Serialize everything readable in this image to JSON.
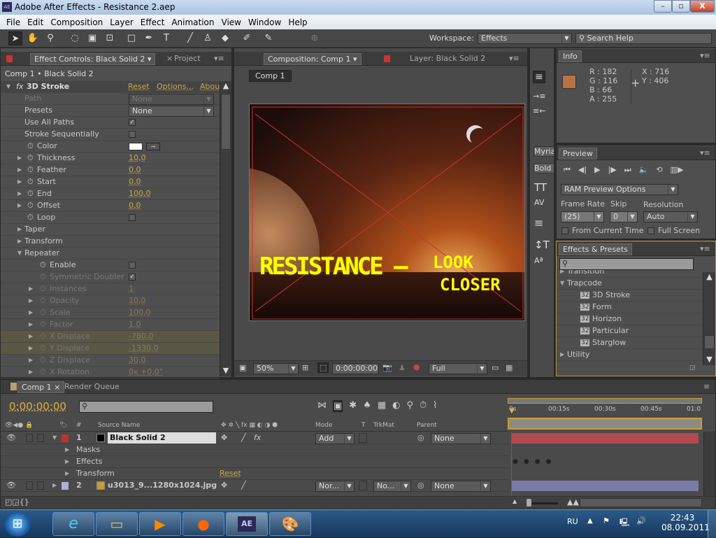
{
  "window": {
    "title": "Adobe After Effects - Resistance 2.aep",
    "app_icon": "AE",
    "minimize": "–",
    "maximize": "▫",
    "close": "X"
  },
  "menu": [
    "File",
    "Edit",
    "Composition",
    "Layer",
    "Effect",
    "Animation",
    "View",
    "Window",
    "Help"
  ],
  "toolbar": {
    "workspace_label": "Workspace:",
    "workspace_value": "Effects",
    "search_placeholder": "Search Help"
  },
  "effect_controls": {
    "tab": "Effect Controls: Black Solid 2",
    "tab_project": "Project",
    "breadcrumb": "Comp 1 • Black Solid 2",
    "effect_name": "3D Stroke",
    "reset": "Reset",
    "options": "Options...",
    "about": "About...",
    "rows": [
      {
        "label": "Path",
        "value": "None",
        "type": "dropdown",
        "dim": true
      },
      {
        "label": "Presets",
        "value": "None",
        "type": "dropdown"
      },
      {
        "label": "Use All Paths",
        "value": "✓",
        "type": "check"
      },
      {
        "label": "Stroke Sequentially",
        "value": "",
        "type": "check"
      },
      {
        "label": "Color",
        "value": "#ffffff",
        "type": "color",
        "sw": true
      },
      {
        "label": "Thickness",
        "value": "10,0",
        "type": "num",
        "sw": true,
        "tw": true
      },
      {
        "label": "Feather",
        "value": "0,0",
        "type": "num",
        "sw": true,
        "tw": true
      },
      {
        "label": "Start",
        "value": "0,0",
        "type": "num",
        "sw": true,
        "tw": true
      },
      {
        "label": "End",
        "value": "100,0",
        "type": "num",
        "sw": true,
        "tw": true
      },
      {
        "label": "Offset",
        "value": "0,0",
        "type": "num",
        "sw": true,
        "tw": true
      },
      {
        "label": "Loop",
        "value": "",
        "type": "check",
        "sw": true
      },
      {
        "label": "Taper",
        "type": "group",
        "tw": true
      },
      {
        "label": "Transform",
        "type": "group",
        "tw": true
      },
      {
        "label": "Repeater",
        "type": "group",
        "tw": true,
        "open": true
      },
      {
        "label": "Enable",
        "value": "",
        "type": "check",
        "sw": true,
        "indent": true
      },
      {
        "label": "Symmetric Doubler",
        "value": "✓",
        "type": "check",
        "sw": true,
        "indent": true,
        "dim": true
      },
      {
        "label": "Instances",
        "value": "1",
        "type": "num",
        "sw": true,
        "tw": true,
        "indent": true,
        "dim": true
      },
      {
        "label": "Opacity",
        "value": "10,0",
        "type": "num",
        "sw": true,
        "tw": true,
        "indent": true,
        "dim": true
      },
      {
        "label": "Scale",
        "value": "100,0",
        "type": "num",
        "sw": true,
        "tw": true,
        "indent": true,
        "dim": true
      },
      {
        "label": "Factor",
        "value": "1,0",
        "type": "num",
        "sw": true,
        "tw": true,
        "indent": true,
        "dim": true
      },
      {
        "label": "X Displace",
        "value": "-780,0",
        "type": "num",
        "sw": true,
        "tw": true,
        "indent": true,
        "dim": true,
        "hl": true
      },
      {
        "label": "Y Displace",
        "value": "-1330,0",
        "type": "num",
        "sw": true,
        "tw": true,
        "indent": true,
        "dim": true,
        "hl": true
      },
      {
        "label": "Z Displace",
        "value": "30,0",
        "type": "num",
        "sw": true,
        "tw": true,
        "indent": true,
        "dim": true
      },
      {
        "label": "X Rotation",
        "value": "0x +0,0°",
        "type": "num",
        "sw": true,
        "tw": true,
        "indent": true,
        "dim": true
      }
    ]
  },
  "composition": {
    "tab": "Composition: Comp 1",
    "layer_tab": "Layer: Black Solid 2",
    "comp_button": "Comp 1",
    "preview_text_1": "RESISTANCE —",
    "preview_text_2": "LOOK",
    "preview_text_3": "CLOSER",
    "zoom": "50%",
    "timecode": "0:00:00:00",
    "resolution": "Full"
  },
  "character": {
    "font": "Myria",
    "style": "Bold"
  },
  "info": {
    "tab": "Info",
    "r": "R : 182",
    "g": "G : 116",
    "b": "B : 66",
    "a": "A : 255",
    "x": "X : 716",
    "y": "Y : 406",
    "swatch": "#b67442"
  },
  "preview": {
    "tab": "Preview",
    "ram_options": "RAM Preview Options",
    "frame_rate_label": "Frame Rate",
    "frame_rate": "(25)",
    "skip_label": "Skip",
    "skip": "0",
    "resolution_label": "Resolution",
    "resolution": "Auto",
    "from_current": "From Current Time",
    "full_screen": "Full Screen"
  },
  "effects_presets": {
    "tab": "Effects & Presets",
    "items": [
      {
        "label": "Transition",
        "type": "folder"
      },
      {
        "label": "Trapcode",
        "type": "folder-open"
      },
      {
        "label": "3D Stroke",
        "type": "effect"
      },
      {
        "label": "Form",
        "type": "effect"
      },
      {
        "label": "Horizon",
        "type": "effect"
      },
      {
        "label": "Particular",
        "type": "effect"
      },
      {
        "label": "Starglow",
        "type": "effect"
      },
      {
        "label": "Utility",
        "type": "folder"
      }
    ]
  },
  "timeline": {
    "tab": "Comp 1",
    "render_queue": "Render Queue",
    "timecode": "0:00:00:00",
    "ruler": [
      "0s",
      "00:15s",
      "00:30s",
      "00:45s",
      "01:0"
    ],
    "headers": {
      "num": "#",
      "source": "Source Name",
      "mode": "Mode",
      "t": "T",
      "trkmat": "TrkMat",
      "parent": "Parent"
    },
    "layers": [
      {
        "num": "1",
        "name": "Black Solid 2",
        "mode": "Add",
        "parent": "None",
        "label_color": "#c03030",
        "bar_color": "#b34a50",
        "trkmat": ""
      },
      {
        "num": "2",
        "name": "u3013_9...1280x1024.jpg",
        "mode": "Nor...",
        "trkmat": "No...",
        "parent": "None",
        "label_color": "#b0b0d0",
        "bar_color": "#7a7aa8"
      }
    ],
    "sub": [
      "Masks",
      "Effects",
      "Transform"
    ],
    "transform_reset": "Reset"
  },
  "taskbar": {
    "lang": "RU",
    "time": "22:43",
    "date": "08.09.2011",
    "apps": [
      "ie",
      "explorer",
      "media-player",
      "firefox",
      "after-effects",
      "paint"
    ],
    "ae_label": "AE"
  }
}
